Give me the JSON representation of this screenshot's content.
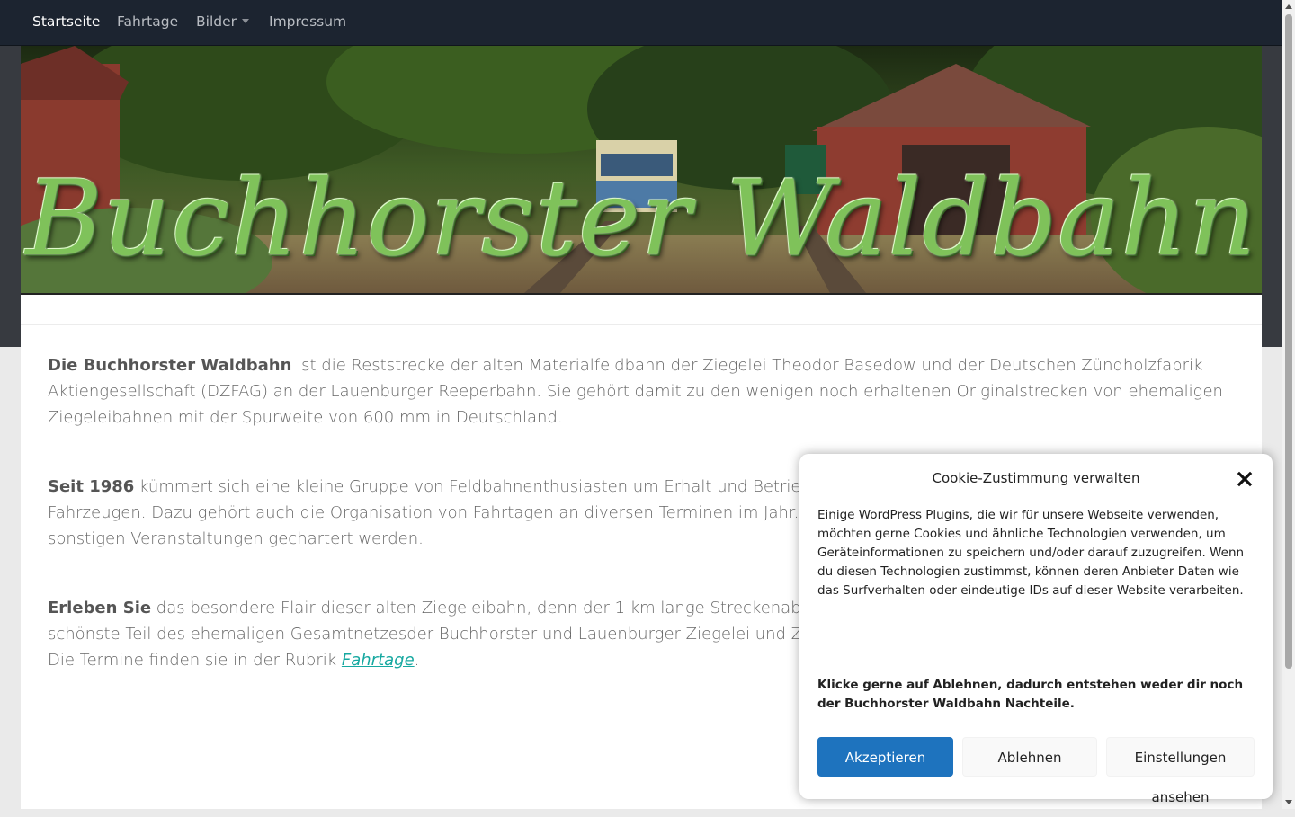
{
  "nav": {
    "items": [
      {
        "label": "Startseite",
        "active": true
      },
      {
        "label": "Fahrtage"
      },
      {
        "label": "Bilder",
        "has_dropdown": true
      },
      {
        "label": "Impressum"
      }
    ]
  },
  "header": {
    "banner_title": "Buchhorster Waldbahn"
  },
  "content": {
    "p1_strong": "Die Buchhorster Waldbahn",
    "p1_text": " ist die Reststrecke der alten Materialfeldbahn der Ziegelei Theodor Basedow und der Deutschen Zündholzfabrik Aktiengesellschaft (DZFAG) an der Lauenburger Reeperbahn. Sie gehört damit zu den wenigen noch erhaltenen Originalstrecken von ehemaligen Ziegeleibahnen mit der Spurweite von 600 mm in Deutschland.",
    "p2_strong": "Seit 1986",
    "p2_text": " kümmert sich eine kleine Gruppe von Feldbahnenthusiasten um Erhalt und Betrieb dieser kleinen Bahn und ihren historischen Fahrzeugen. Dazu gehört auch die Organisation von Fahrtagen an diversen Terminen im Jahr. Außerdem kann die Bahn für Geburtstage und sonstigen Veranstaltungen gechartert werden.",
    "p3_strong": "Erleben Sie",
    "p3_text": " das besondere Flair dieser alten Ziegeleibahn, denn der 1 km lange Streckenabschnitt in der Buchhorst ist der landschaftlich schönste Teil des ehemaligen Gesamtnetzesder Buchhorster und Lauenburger Ziegelei und Zündholzfabrik. Schauen Sie doch einfach mal vorbei. Die Termine finden sie in der Rubrik ",
    "p3_link": "Fahrtage",
    "p3_end": "."
  },
  "cookie": {
    "title": "Cookie-Zustimmung verwalten",
    "text": "Einige WordPress Plugins, die wir für unsere Webseite verwenden, möchten gerne Cookies und ähnliche Technologien verwenden, um Geräteinformationen zu speichern und/oder darauf zuzugreifen. Wenn du diesen Technologien zustimmst, können deren Anbieter Daten wie das Surfverhalten oder eindeutige IDs auf dieser Website verarbeiten.",
    "bold_text": "Klicke gerne auf Ablehnen, dadurch entstehen weder dir noch der Buchhorster Waldbahn Nachteile.",
    "accept_label": "Akzeptieren",
    "deny_label": "Ablehnen",
    "prefs_label": "Einstellungen ansehen",
    "accent_color": "#1e73be"
  },
  "icons": {
    "close": "close-icon",
    "dropdown": "caret-down-icon"
  }
}
